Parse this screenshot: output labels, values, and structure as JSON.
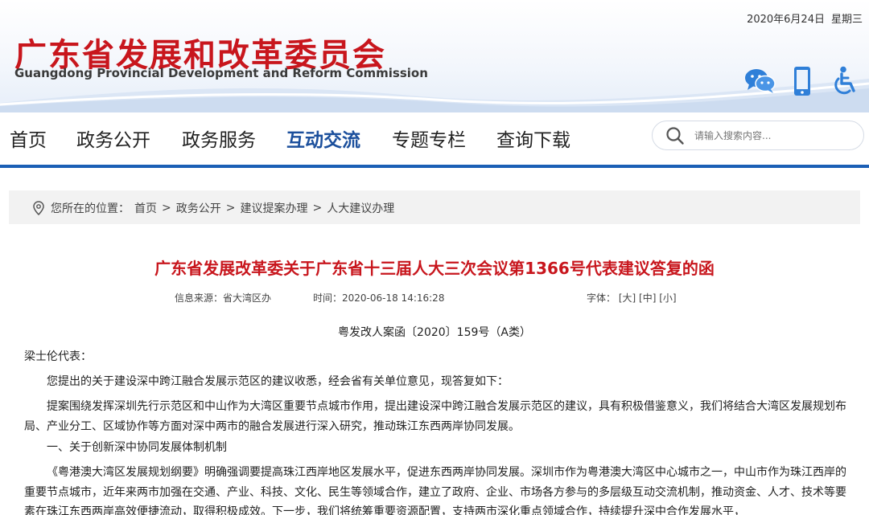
{
  "header": {
    "date": "2020年6月24日",
    "weekday": "星期三",
    "title_cn": "广东省发展和改革委员会",
    "title_en": "Guangdong Provincial Development and Reform Commission",
    "icons": [
      "wechat-icon",
      "mobile-icon",
      "accessibility-icon"
    ],
    "accent_color": "#c8161d",
    "brand_blue": "#1b5fb5"
  },
  "nav": {
    "items": [
      "首页",
      "政务公开",
      "政务服务",
      "互动交流",
      "专题专栏",
      "查询下载"
    ],
    "active": "互动交流",
    "search_placeholder": "请输入搜索内容..."
  },
  "breadcrumb": {
    "label": "您所在的位置：",
    "items": [
      "首页",
      "政务公开",
      "建议提案办理",
      "人大建议办理"
    ],
    "separator": ">"
  },
  "article": {
    "title": "广东省发展改革委关于广东省十三届人大三次会议第1366号代表建议答复的函",
    "source": "信息来源：省大湾区办",
    "time": "时间：2020-06-18 14:16:28",
    "font_label": "字体：",
    "font_large": "[大]",
    "font_medium": "[中]",
    "font_small": "[小]",
    "doc_number": "粤发改人案函〔2020〕159号（A类）",
    "salutation": "梁士伦代表：",
    "paragraphs": [
      "您提出的关于建设深中跨江融合发展示范区的建议收悉，经会省有关单位意见，现答复如下：",
      "提案围绕发挥深圳先行示范区和中山作为大湾区重要节点城市作用，提出建设深中跨江融合发展示范区的建议，具有积极借鉴意义，我们将结合大湾区发展规划布局、产业分工、区域协作等方面对深中两市的融合发展进行深入研究，推动珠江东西两岸协同发展。",
      "一、关于创新深中协同发展体制机制",
      "《粤港澳大湾区发展规划纲要》明确强调要提高珠江西岸地区发展水平，促进东西两岸协同发展。深圳市作为粤港澳大湾区中心城市之一，中山市作为珠江西岸的重要节点城市，近年来两市加强在交通、产业、科技、文化、民生等领域合作，建立了政府、企业、市场各方参与的多层级互动交流机制，推动资金、人才、技术等要素在珠江东西两岸高效便捷流动，取得积极成效。下一步，我们将统筹重要资源配置，支持两市深化重点领域合作，持续提升深中合作发展水平，"
    ]
  }
}
